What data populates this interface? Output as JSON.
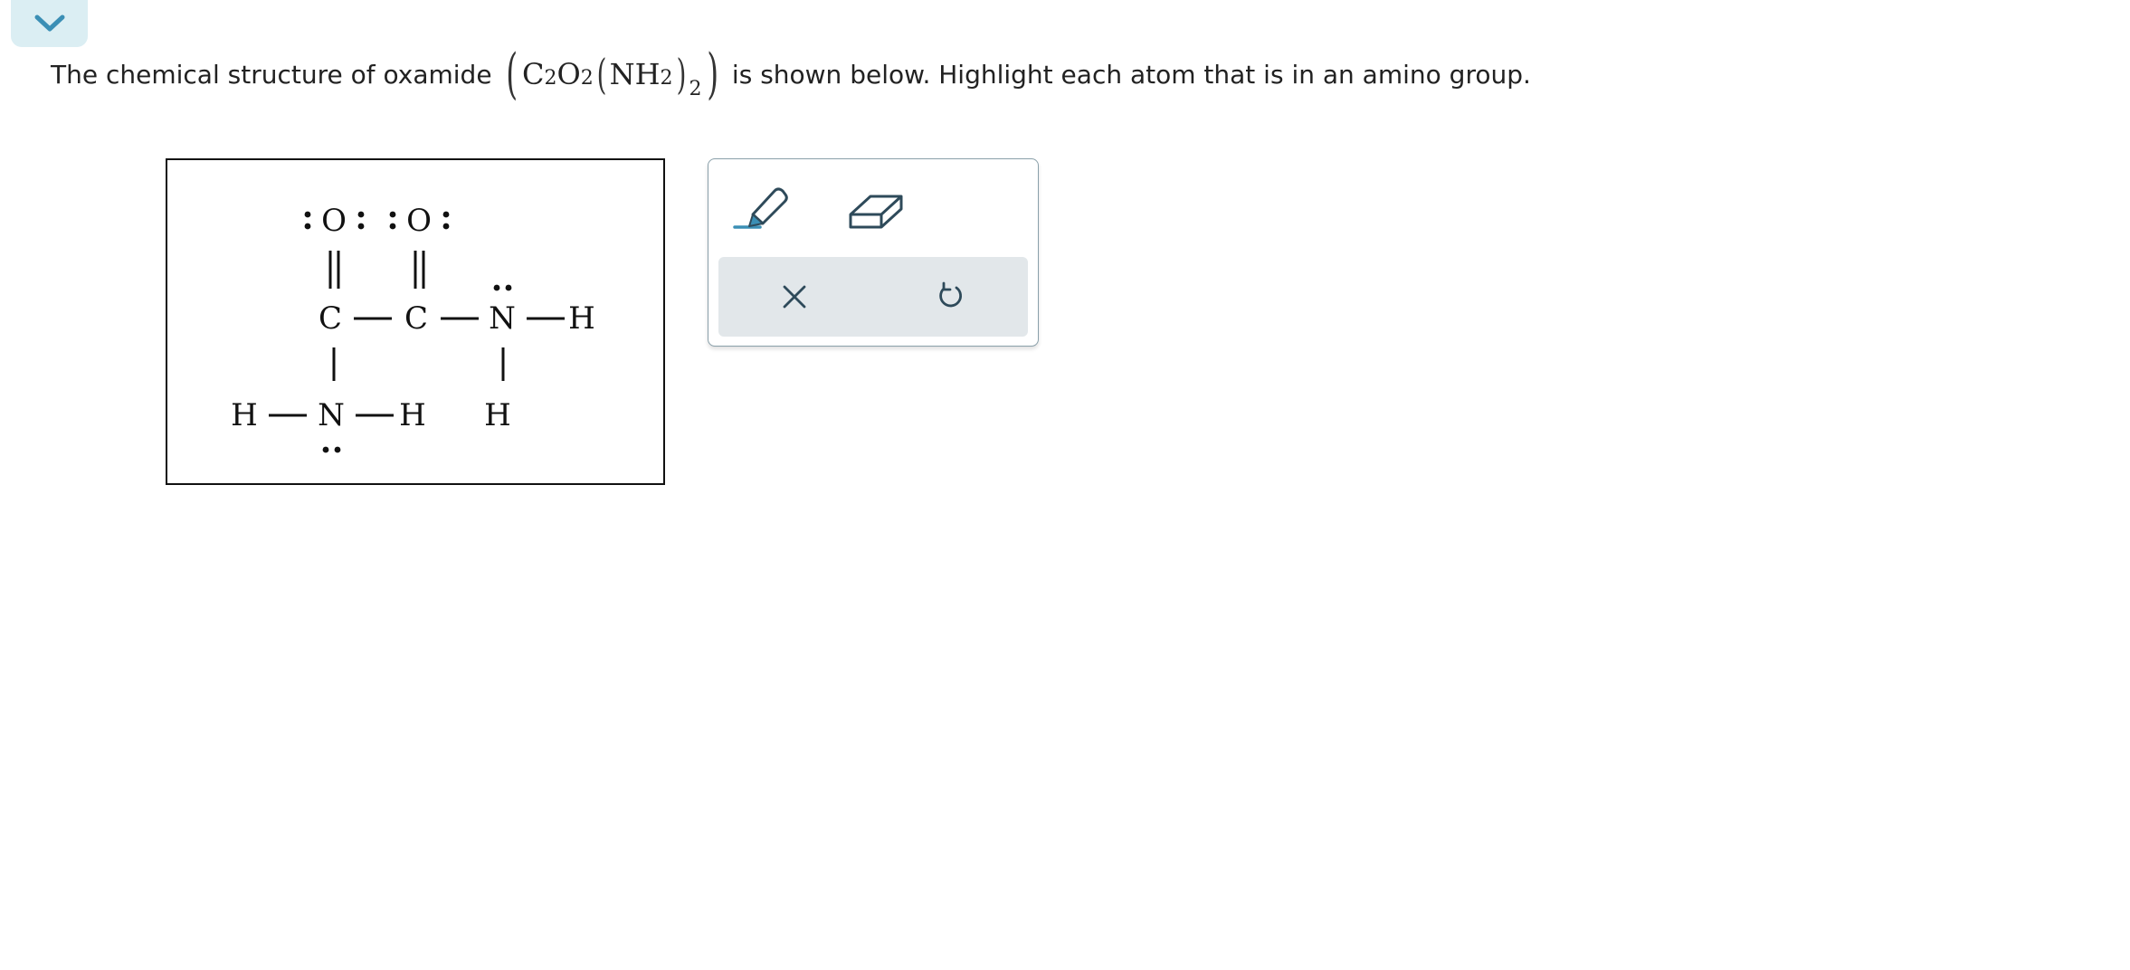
{
  "collapse_tab": {
    "icon": "chevron-down-icon",
    "color": "#3b8fb5"
  },
  "question": {
    "text_before": "The chemical structure of oxamide",
    "text_after": "is shown below. Highlight each atom that is in an amino group.",
    "formula": {
      "c": "C",
      "c_sub": "2",
      "o": "O",
      "o_sub": "2",
      "nh": "NH",
      "nh_sub": "2",
      "outer_sub": "2"
    }
  },
  "structure": {
    "atoms": {
      "o_left": "O",
      "o_right": "O",
      "c_left": "C",
      "c_right": "C",
      "n_right": "N",
      "h_n_right_end": "H",
      "h_n_right_below": "H",
      "h_n_left_start": "H",
      "n_left": "N",
      "h_n_left_end": "H"
    }
  },
  "toolbar": {
    "tools": [
      "pencil-highlight-icon",
      "eraser-icon"
    ],
    "actions": [
      "clear-x-icon",
      "undo-icon"
    ],
    "accent_color": "#3b8fb5",
    "icon_color": "#2e4a5a"
  }
}
